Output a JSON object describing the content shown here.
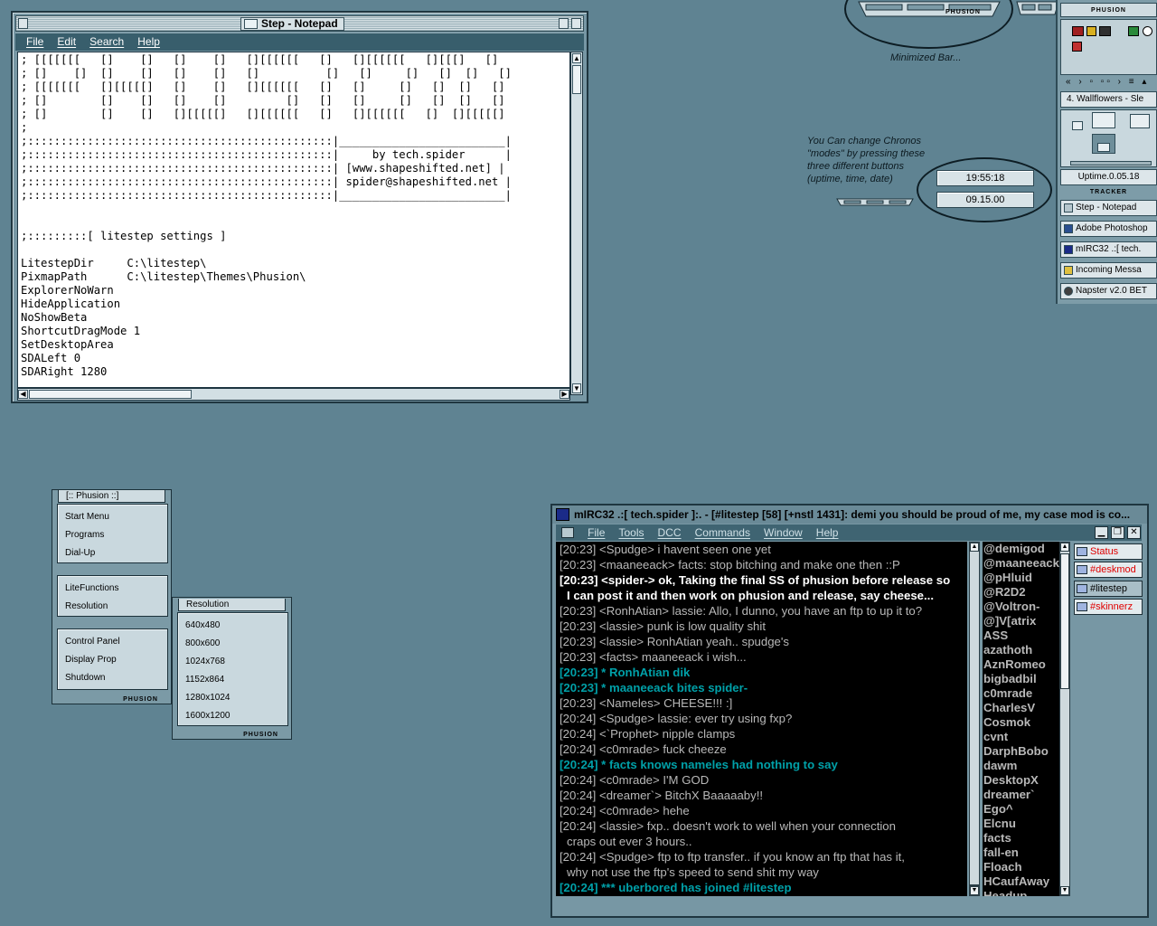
{
  "notepad": {
    "title": "Step - Notepad",
    "menu": [
      "File",
      "Edit",
      "Search",
      "Help"
    ],
    "content": "; [[[[[[[   []    []   []    []   [][[[[[[   []   [][[[[[[   [][[[]   []\n; []    []  []    []   []    []   []          []   []     []   []  []   []\n; [[[[[[[   [][[[[[]   []    []   [][[[[[[   []   []     []   []  []   []\n; []        []    []   []    []         []   []   []     []   []  []   []\n; []        []    []   [][[[[[]   [][[[[[[   []   [][[[[[[   []  [][[[[[]\n;\n;::::::::::::::::::::::::::::::::::::::::::::::|_________________________|\n;::::::::::::::::::::::::::::::::::::::::::::::|     by tech.spider      |\n;::::::::::::::::::::::::::::::::::::::::::::::| [www.shapeshifted.net] |\n;::::::::::::::::::::::::::::::::::::::::::::::| spider@shapeshifted.net |\n;::::::::::::::::::::::::::::::::::::::::::::::|_________________________|\n\n\n;:::::::::[ litestep settings ]\n\nLitestepDir     C:\\litestep\\\nPixmapPath      C:\\litestep\\Themes\\Phusion\\\nExplorerNoWarn\nHideApplication\nNoShowBeta\nShortcutDragMode 1\nSetDesktopArea\nSDALeft 0\nSDARight 1280"
  },
  "annotations": {
    "minimized_bar": "Minimized Bar...",
    "chronos": "You Can change Chronos\n\"modes\" by pressing these\nthree different buttons\n(uptime, time, date)"
  },
  "branding": {
    "phusion": "PHUSION",
    "tracker": "TRACKER"
  },
  "dock": {
    "track": "4. Wallflowers - Sle",
    "uptime": "Uptime.0.05.18",
    "tasks": [
      "Step - Notepad",
      "Adobe Photoshop",
      "mIRC32 .:[ tech.",
      "Incoming Messa",
      "Napster v2.0 BET"
    ]
  },
  "clocks": {
    "time": "19:55:18",
    "date": "09.15.00"
  },
  "popup_menu": {
    "title": "[:: Phusion ::]",
    "group1": [
      "Start Menu",
      "Programs",
      "Dial-Up"
    ],
    "group2": [
      "LiteFunctions",
      "Resolution"
    ],
    "group3": [
      "Control Panel",
      "Display Prop",
      "Shutdown"
    ]
  },
  "resolution_menu": {
    "title": "Resolution",
    "items": [
      "640x480",
      "800x600",
      "1024x768",
      "1152x864",
      "1280x1024",
      "1600x1200"
    ]
  },
  "mirc": {
    "title": "mIRC32 .:[ tech.spider ]:. - [#litestep [58] [+nstl 1431]: demi you should be proud of me, my case mod is co...",
    "menu": [
      "File",
      "Tools",
      "DCC",
      "Commands",
      "Window",
      "Help"
    ],
    "chat": [
      {
        "text": "[20:23] <Spudge> i havent seen one yet",
        "style": "normal"
      },
      {
        "text": "[20:23] <maaneeack> facts: stop bitching and make one then ::P",
        "style": "normal"
      },
      {
        "text": "[20:23] <spider-> ok, Taking the final SS of phusion before release so",
        "style": "bright"
      },
      {
        "text": "I can post it and then work on phusion and release, say cheese...",
        "style": "bright cont"
      },
      {
        "text": "[20:23] <RonhAtian> lassie: Allo, I dunno, you have an ftp to up it to?",
        "style": "normal"
      },
      {
        "text": "[20:23] <lassie> punk is low quality shit",
        "style": "normal"
      },
      {
        "text": "[20:23] <lassie> RonhAtian yeah.. spudge's",
        "style": "normal"
      },
      {
        "text": "[20:23] <facts> maaneeack i wish...",
        "style": "normal"
      },
      {
        "text": "[20:23] * RonhAtian dik",
        "style": "action"
      },
      {
        "text": "[20:23] * maaneeack bites spider-",
        "style": "action"
      },
      {
        "text": "[20:23] <Nameles> CHEESE!!! :]",
        "style": "normal"
      },
      {
        "text": "[20:24] <Spudge> lassie: ever try using fxp?",
        "style": "normal"
      },
      {
        "text": "[20:24] <`Prophet> nipple clamps",
        "style": "normal"
      },
      {
        "text": "[20:24] <c0mrade> fuck cheeze",
        "style": "normal"
      },
      {
        "text": "[20:24] * facts knows nameles had nothing to say",
        "style": "action"
      },
      {
        "text": "[20:24] <c0mrade> I'M GOD",
        "style": "normal"
      },
      {
        "text": "[20:24] <dreamer`> BitchX Baaaaaby!!",
        "style": "normal"
      },
      {
        "text": "[20:24] <c0mrade> hehe",
        "style": "normal"
      },
      {
        "text": "[20:24] <lassie> fxp.. doesn't work to well when your connection",
        "style": "normal"
      },
      {
        "text": "craps out ever 3 hours..",
        "style": "normal cont"
      },
      {
        "text": "[20:24] <Spudge> ftp to ftp transfer.. if you know an ftp that has it,",
        "style": "normal"
      },
      {
        "text": "why not use the ftp's speed to send shit my way",
        "style": "normal cont"
      },
      {
        "text": "[20:24] *** uberbored has joined #litestep",
        "style": "action"
      }
    ],
    "nicks": [
      "@demigod",
      "@maaneeack",
      "@pHluid",
      "@R2D2",
      "@Voltron-",
      "@]V[atrix",
      "ASS",
      "azathoth",
      "AznRomeo",
      "bigbadbil",
      "c0mrade",
      "CharlesV",
      "Cosmok",
      "cvnt",
      "DarphBobo",
      "dawm",
      "DesktopX",
      "dreamer`",
      "Ego^",
      "Elcnu",
      "facts",
      "fall-en",
      "Floach",
      "HCaufAway",
      "Headup"
    ],
    "switchbar": [
      {
        "label": "Status",
        "active": false
      },
      {
        "label": "#deskmod",
        "active": false
      },
      {
        "label": "#litestep",
        "active": true
      },
      {
        "label": "#skinnerz",
        "active": false
      }
    ]
  }
}
